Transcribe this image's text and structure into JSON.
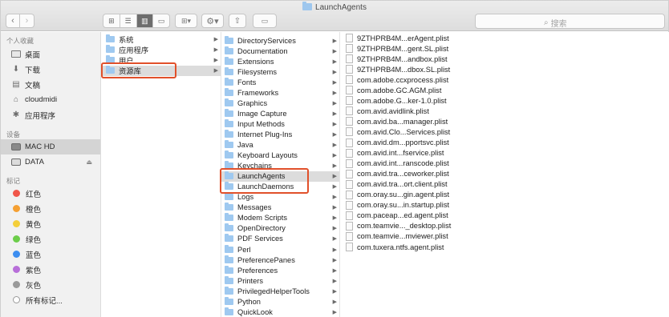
{
  "window": {
    "title": "LaunchAgents"
  },
  "toolbar": {
    "back_icon": "‹",
    "forward_icon": "›",
    "view_icons": [
      "⊞",
      "☰",
      "▥",
      "▭"
    ],
    "arrange_icon": "⊞▾",
    "action_icon": "⚙▾",
    "share_icon": "⇧",
    "tag_icon": "▭",
    "search_placeholder": "搜索",
    "search_icon": "⌕"
  },
  "sidebar": {
    "favorites_header": "个人收藏",
    "favorites": [
      {
        "label": "桌面",
        "icon": "desktop-icon"
      },
      {
        "label": "下载",
        "icon": "downloads-icon"
      },
      {
        "label": "文稿",
        "icon": "documents-icon"
      },
      {
        "label": "cloudmidi",
        "icon": "home-icon"
      },
      {
        "label": "应用程序",
        "icon": "applications-icon"
      }
    ],
    "devices_header": "设备",
    "devices": [
      {
        "label": "MAC HD",
        "icon": "hard-drive-icon",
        "selected": true
      },
      {
        "label": "DATA",
        "icon": "disk-icon",
        "eject": "⏏"
      }
    ],
    "tags_header": "标记",
    "tags": [
      {
        "label": "红色",
        "color": "#f0564a"
      },
      {
        "label": "橙色",
        "color": "#f5a033"
      },
      {
        "label": "黄色",
        "color": "#f4cf3a"
      },
      {
        "label": "绿色",
        "color": "#6ccd4a"
      },
      {
        "label": "蓝色",
        "color": "#3d8ef0"
      },
      {
        "label": "紫色",
        "color": "#b86fd9"
      },
      {
        "label": "灰色",
        "color": "#9a9a9a"
      },
      {
        "label": "所有标记...",
        "color": ""
      }
    ]
  },
  "columns": {
    "col1": [
      "系统",
      "应用程序",
      "用户",
      "资源库"
    ],
    "col1_selected": "资源库",
    "col2": [
      "DirectoryServices",
      "Documentation",
      "Extensions",
      "Filesystems",
      "Fonts",
      "Frameworks",
      "Graphics",
      "Image Capture",
      "Input Methods",
      "Internet Plug-Ins",
      "Java",
      "Keyboard Layouts",
      "Keychains",
      "LaunchAgents",
      "LaunchDaemons",
      "Logs",
      "Messages",
      "Modem Scripts",
      "OpenDirectory",
      "PDF Services",
      "Perl",
      "PreferencePanes",
      "Preferences",
      "Printers",
      "PrivilegedHelperTools",
      "Python",
      "QuickLook"
    ],
    "col2_selected": "LaunchAgents",
    "col3": [
      "9ZTHPRB4M...erAgent.plist",
      "9ZTHPRB4M...gent.SL.plist",
      "9ZTHPRB4M...andbox.plist",
      "9ZTHPRB4M...dbox.SL.plist",
      "com.adobe.ccxprocess.plist",
      "com.adobe.GC.AGM.plist",
      "com.adobe.G...ker-1.0.plist",
      "com.avid.avidlink.plist",
      "com.avid.ba...manager.plist",
      "com.avid.Clo...Services.plist",
      "com.avid.dm...pportsvc.plist",
      "com.avid.int...fservice.plist",
      "com.avid.int...ranscode.plist",
      "com.avid.tra...ceworker.plist",
      "com.avid.tra...ort.client.plist",
      "com.oray.su...gin.agent.plist",
      "com.oray.su...in.startup.plist",
      "com.paceap...ed.agent.plist",
      "com.teamvie..._desktop.plist",
      "com.teamvie...mviewer.plist",
      "com.tuxera.ntfs.agent.plist"
    ]
  }
}
